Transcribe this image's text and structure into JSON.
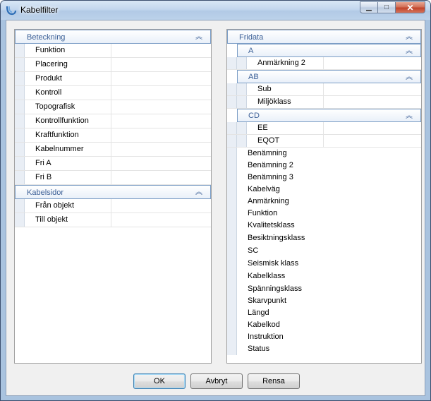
{
  "window": {
    "title": "Kabelfilter"
  },
  "left": {
    "groups": [
      {
        "title": "Beteckning",
        "items": [
          "Funktion",
          "Placering",
          "Produkt",
          "Kontroll",
          "Topografisk",
          "Kontrollfunktion",
          "Kraftfunktion",
          "Kabelnummer",
          "Fri A",
          "Fri B"
        ]
      },
      {
        "title": "Kabelsidor",
        "items": [
          "Från objekt",
          "Till objekt"
        ]
      }
    ]
  },
  "right": {
    "title": "Fridata",
    "subgroups": [
      {
        "title": "A",
        "items": [
          "Anmärkning 2"
        ]
      },
      {
        "title": "AB",
        "items": [
          "Sub",
          "Miljöklass"
        ]
      },
      {
        "title": "CD",
        "items": [
          "EE",
          "EQOT"
        ]
      }
    ],
    "items": [
      "Benämning",
      "Benämning 2",
      "Benämning 3",
      "Kabelväg",
      "Anmärkning",
      "Funktion",
      "Kvalitetsklass",
      "Besiktningsklass",
      "SC",
      "Seismisk klass",
      "Kabelklass",
      "Spänningsklass",
      "Skarvpunkt",
      "Längd",
      "Kabelkod",
      "Instruktion",
      "Status"
    ]
  },
  "buttons": {
    "ok": "OK",
    "cancel": "Avbryt",
    "clear": "Rensa"
  }
}
